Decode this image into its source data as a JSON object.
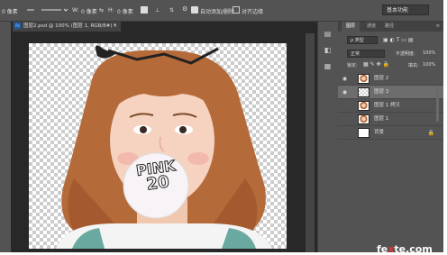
{
  "options_bar": {
    "zoom_label": "0 像素",
    "offset_a": "0 像素",
    "offset_b": "0 像素",
    "auto_add_delete": "自动添加/删除",
    "align_edges": "对齐边缘",
    "workspace": "基本功能"
  },
  "document": {
    "tab_title": "图层2.psd @ 100% (图层 1, RGB/8#) *",
    "ps_badge": "Ps",
    "close": "×"
  },
  "bubble": {
    "line1": "PINK",
    "line2": "20"
  },
  "panel": {
    "tabs": [
      "图层",
      "通道",
      "路径"
    ],
    "kind": "ρ 类型",
    "blend_mode": "正常",
    "opacity_label": "不透明度:",
    "opacity_value": "100%",
    "lock_label": "锁定:",
    "fill_label": "填充:",
    "fill_value": "100%",
    "layers": [
      {
        "name": "图层 2",
        "visible": true,
        "selected": false,
        "thumb": "portrait"
      },
      {
        "name": "图层 3",
        "visible": true,
        "selected": true,
        "thumb": "transparent"
      },
      {
        "name": "图层 1 拷贝",
        "visible": false,
        "selected": false,
        "thumb": "portrait"
      },
      {
        "name": "图层 1",
        "visible": false,
        "selected": false,
        "thumb": "portrait"
      },
      {
        "name": "背景",
        "visible": false,
        "selected": false,
        "thumb": "white",
        "lock": "🔒"
      }
    ]
  },
  "watermark": {
    "prefix": "fe",
    "mid": "x",
    "suffix": "te.com"
  }
}
